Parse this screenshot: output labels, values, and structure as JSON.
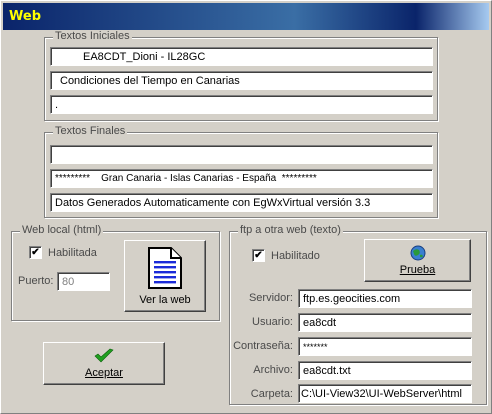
{
  "window": {
    "title": "Web"
  },
  "textos_iniciales": {
    "legend": "Textos Iniciales",
    "line1": "EA8CDT_Dioni - IL28GC",
    "line2": "Condiciones del Tiempo en Canarias",
    "line3": "."
  },
  "textos_finales": {
    "legend": "Textos Finales",
    "line1": "",
    "line2": "*********    Gran Canaria - Islas Canarias - España  *********",
    "line3": "Datos Generados Automaticamente con EgWxVirtual versión 3.3"
  },
  "web_local": {
    "legend": "Web local (html)",
    "habilitada_label": "Habilitada",
    "habilitada_checked": "✔",
    "puerto_label": "Puerto:",
    "puerto_value": "80",
    "ver_button": "Ver la web"
  },
  "ftp": {
    "legend": "ftp a otra web (texto)",
    "habilitado_label": "Habilitado",
    "habilitado_checked": "✔",
    "prueba_button": "Prueba",
    "servidor_label": "Servidor:",
    "servidor_value": "ftp.es.geocities.com",
    "usuario_label": "Usuario:",
    "usuario_value": "ea8cdt",
    "password_label": "Contraseña:",
    "password_value": "*******",
    "archivo_label": "Archivo:",
    "archivo_value": "ea8cdt.txt",
    "carpeta_label": "Carpeta:",
    "carpeta_value": "C:\\UI-View32\\UI-WebServer\\html"
  },
  "aceptar_button": "Aceptar",
  "icons": {
    "web_doc": "document-icon",
    "globe": "globe-icon",
    "check": "green-check-icon"
  },
  "colors": {
    "title_text": "#ffff00",
    "title_bar": "#0a246a",
    "face": "#d4d0c8"
  }
}
